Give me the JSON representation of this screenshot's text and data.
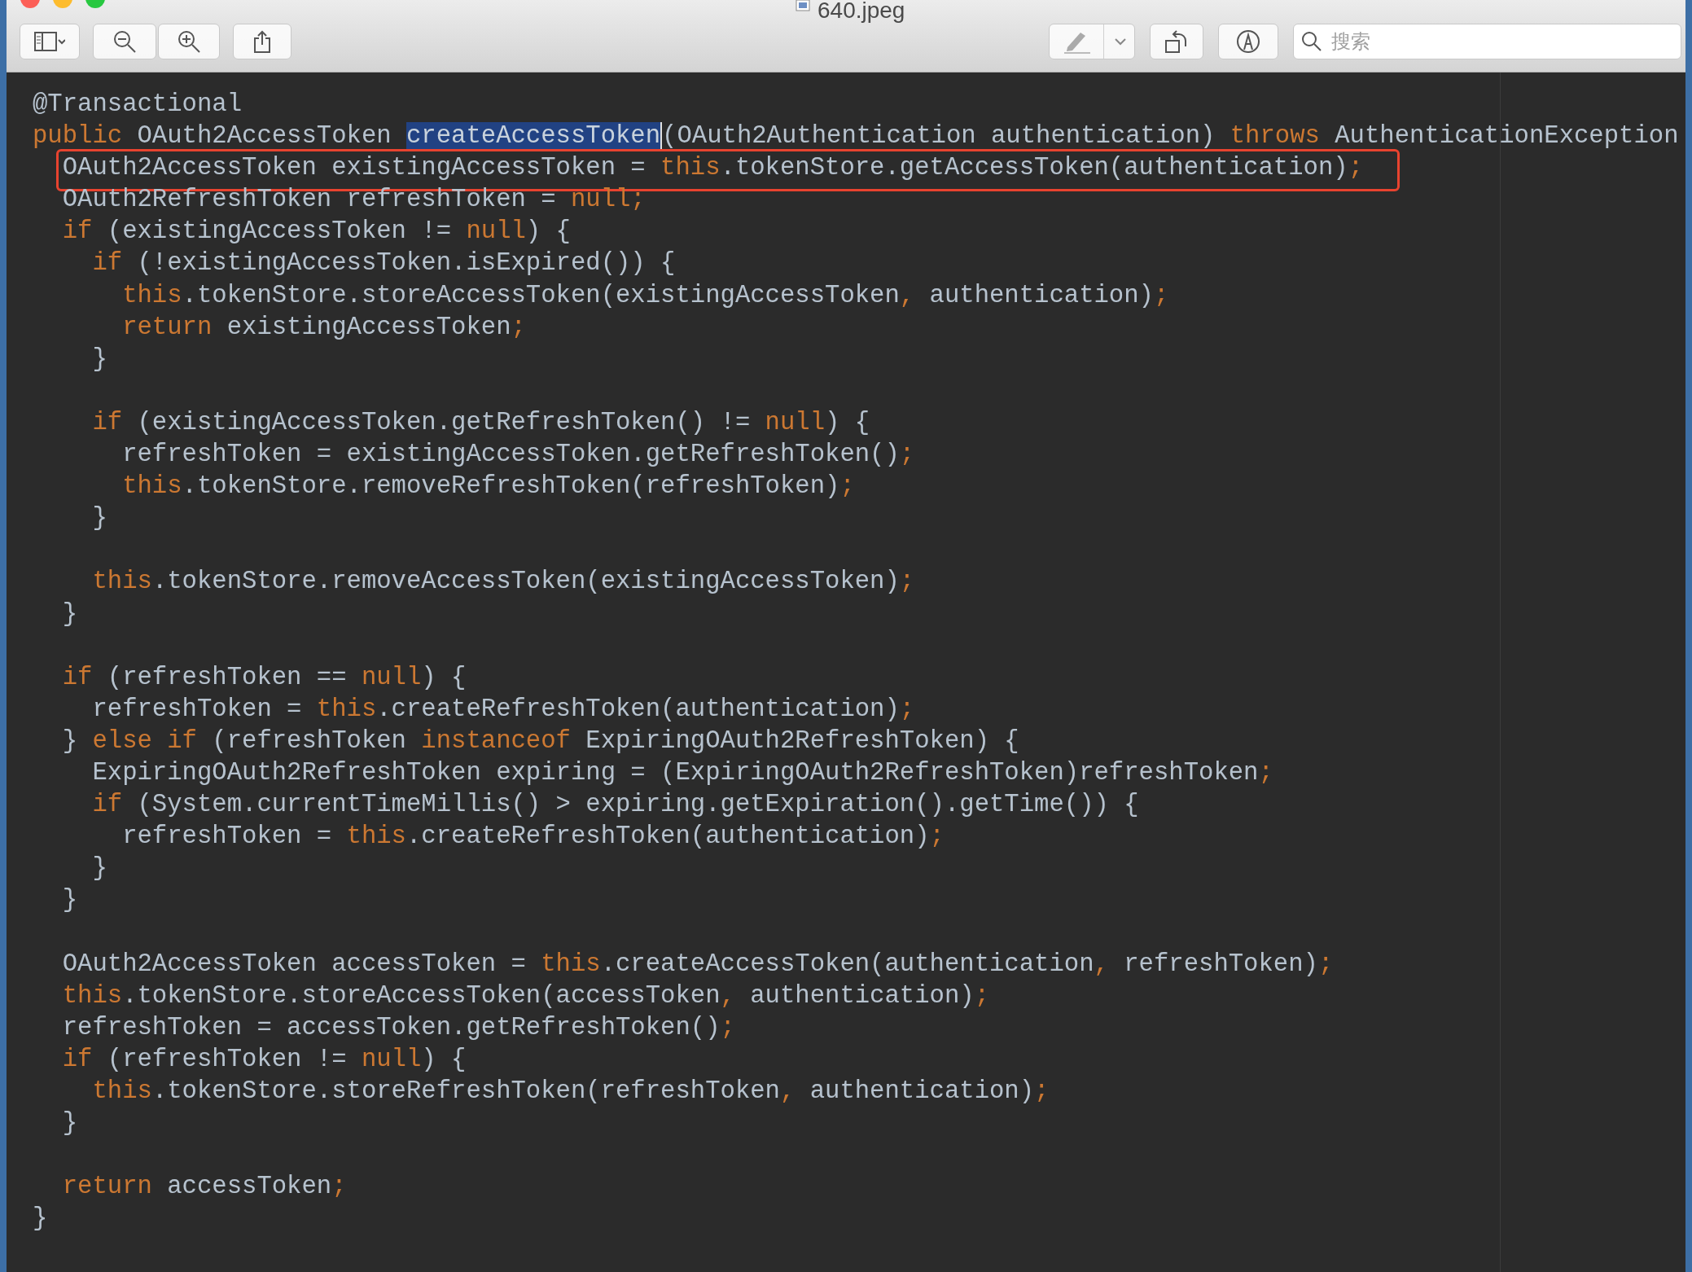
{
  "window": {
    "title": "640.jpeg"
  },
  "search": {
    "placeholder": "搜索"
  },
  "code": {
    "lines": [
      {
        "kind": "code",
        "boxed": false,
        "tokens": [
          {
            "kind": "plain",
            "text": "@Transactional"
          }
        ]
      },
      {
        "kind": "code",
        "boxed": false,
        "tokens": [
          {
            "kind": "keyword",
            "text": "public"
          },
          {
            "kind": "plain",
            "text": " OAuth2AccessToken "
          },
          {
            "kind": "selected",
            "text": "createAccessToken"
          },
          {
            "kind": "plain",
            "text": "(OAuth2Authentication authentication) "
          },
          {
            "kind": "keyword",
            "text": "throws"
          },
          {
            "kind": "plain",
            "text": " AuthenticationException"
          }
        ]
      },
      {
        "kind": "code",
        "boxed": true,
        "tokens": [
          {
            "kind": "plain",
            "text": "  OAuth2AccessToken existingAccessToken = "
          },
          {
            "kind": "keyword",
            "text": "this"
          },
          {
            "kind": "plain",
            "text": ".tokenStore.getAccessToken(authentication)"
          },
          {
            "kind": "keyword",
            "text": ";"
          }
        ]
      },
      {
        "kind": "code",
        "boxed": false,
        "tokens": [
          {
            "kind": "plain",
            "text": "  OAuth2RefreshToken refreshToken = "
          },
          {
            "kind": "keyword",
            "text": "null;"
          }
        ]
      },
      {
        "kind": "code",
        "boxed": false,
        "tokens": [
          {
            "kind": "keyword",
            "text": "  if"
          },
          {
            "kind": "plain",
            "text": " (existingAccessToken != "
          },
          {
            "kind": "keyword",
            "text": "null"
          },
          {
            "kind": "plain",
            "text": ") {"
          }
        ]
      },
      {
        "kind": "code",
        "boxed": false,
        "tokens": [
          {
            "kind": "keyword",
            "text": "    if"
          },
          {
            "kind": "plain",
            "text": " (!existingAccessToken.isExpired()) {"
          }
        ]
      },
      {
        "kind": "code",
        "boxed": false,
        "tokens": [
          {
            "kind": "keyword",
            "text": "      this"
          },
          {
            "kind": "plain",
            "text": ".tokenStore.storeAccessToken(existingAccessToken"
          },
          {
            "kind": "keyword",
            "text": ","
          },
          {
            "kind": "plain",
            "text": " authentication)"
          },
          {
            "kind": "keyword",
            "text": ";"
          }
        ]
      },
      {
        "kind": "code",
        "boxed": false,
        "tokens": [
          {
            "kind": "keyword",
            "text": "      return"
          },
          {
            "kind": "plain",
            "text": " existingAccessToken"
          },
          {
            "kind": "keyword",
            "text": ";"
          }
        ]
      },
      {
        "kind": "code",
        "boxed": false,
        "tokens": [
          {
            "kind": "plain",
            "text": "    }"
          }
        ]
      },
      {
        "kind": "blank"
      },
      {
        "kind": "code",
        "boxed": false,
        "tokens": [
          {
            "kind": "keyword",
            "text": "    if"
          },
          {
            "kind": "plain",
            "text": " (existingAccessToken.getRefreshToken() != "
          },
          {
            "kind": "keyword",
            "text": "null"
          },
          {
            "kind": "plain",
            "text": ") {"
          }
        ]
      },
      {
        "kind": "code",
        "boxed": false,
        "tokens": [
          {
            "kind": "plain",
            "text": "      refreshToken = existingAccessToken.getRefreshToken()"
          },
          {
            "kind": "keyword",
            "text": ";"
          }
        ]
      },
      {
        "kind": "code",
        "boxed": false,
        "tokens": [
          {
            "kind": "keyword",
            "text": "      this"
          },
          {
            "kind": "plain",
            "text": ".tokenStore.removeRefreshToken(refreshToken)"
          },
          {
            "kind": "keyword",
            "text": ";"
          }
        ]
      },
      {
        "kind": "code",
        "boxed": false,
        "tokens": [
          {
            "kind": "plain",
            "text": "    }"
          }
        ]
      },
      {
        "kind": "blank"
      },
      {
        "kind": "code",
        "boxed": false,
        "tokens": [
          {
            "kind": "keyword",
            "text": "    this"
          },
          {
            "kind": "plain",
            "text": ".tokenStore.removeAccessToken(existingAccessToken)"
          },
          {
            "kind": "keyword",
            "text": ";"
          }
        ]
      },
      {
        "kind": "code",
        "boxed": false,
        "tokens": [
          {
            "kind": "plain",
            "text": "  }"
          }
        ]
      },
      {
        "kind": "blank"
      },
      {
        "kind": "code",
        "boxed": false,
        "tokens": [
          {
            "kind": "keyword",
            "text": "  if"
          },
          {
            "kind": "plain",
            "text": " (refreshToken == "
          },
          {
            "kind": "keyword",
            "text": "null"
          },
          {
            "kind": "plain",
            "text": ") {"
          }
        ]
      },
      {
        "kind": "code",
        "boxed": false,
        "tokens": [
          {
            "kind": "plain",
            "text": "    refreshToken = "
          },
          {
            "kind": "keyword",
            "text": "this"
          },
          {
            "kind": "plain",
            "text": ".createRefreshToken(authentication)"
          },
          {
            "kind": "keyword",
            "text": ";"
          }
        ]
      },
      {
        "kind": "code",
        "boxed": false,
        "tokens": [
          {
            "kind": "plain",
            "text": "  } "
          },
          {
            "kind": "keyword",
            "text": "else if"
          },
          {
            "kind": "plain",
            "text": " (refreshToken "
          },
          {
            "kind": "keyword",
            "text": "instanceof"
          },
          {
            "kind": "plain",
            "text": " ExpiringOAuth2RefreshToken) {"
          }
        ]
      },
      {
        "kind": "code",
        "boxed": false,
        "tokens": [
          {
            "kind": "plain",
            "text": "    ExpiringOAuth2RefreshToken expiring = (ExpiringOAuth2RefreshToken)refreshToken"
          },
          {
            "kind": "keyword",
            "text": ";"
          }
        ]
      },
      {
        "kind": "code",
        "boxed": false,
        "tokens": [
          {
            "kind": "keyword",
            "text": "    if"
          },
          {
            "kind": "plain",
            "text": " (System.currentTimeMillis() > expiring.getExpiration().getTime()) {"
          }
        ]
      },
      {
        "kind": "code",
        "boxed": false,
        "tokens": [
          {
            "kind": "plain",
            "text": "      refreshToken = "
          },
          {
            "kind": "keyword",
            "text": "this"
          },
          {
            "kind": "plain",
            "text": ".createRefreshToken(authentication)"
          },
          {
            "kind": "keyword",
            "text": ";"
          }
        ]
      },
      {
        "kind": "code",
        "boxed": false,
        "tokens": [
          {
            "kind": "plain",
            "text": "    }"
          }
        ]
      },
      {
        "kind": "code",
        "boxed": false,
        "tokens": [
          {
            "kind": "plain",
            "text": "  }"
          }
        ]
      },
      {
        "kind": "blank"
      },
      {
        "kind": "code",
        "boxed": false,
        "tokens": [
          {
            "kind": "plain",
            "text": "  OAuth2AccessToken accessToken = "
          },
          {
            "kind": "keyword",
            "text": "this"
          },
          {
            "kind": "plain",
            "text": ".createAccessToken(authentication"
          },
          {
            "kind": "keyword",
            "text": ","
          },
          {
            "kind": "plain",
            "text": " refreshToken)"
          },
          {
            "kind": "keyword",
            "text": ";"
          }
        ]
      },
      {
        "kind": "code",
        "boxed": false,
        "tokens": [
          {
            "kind": "keyword",
            "text": "  this"
          },
          {
            "kind": "plain",
            "text": ".tokenStore.storeAccessToken(accessToken"
          },
          {
            "kind": "keyword",
            "text": ","
          },
          {
            "kind": "plain",
            "text": " authentication)"
          },
          {
            "kind": "keyword",
            "text": ";"
          }
        ]
      },
      {
        "kind": "code",
        "boxed": false,
        "tokens": [
          {
            "kind": "plain",
            "text": "  refreshToken = accessToken.getRefreshToken()"
          },
          {
            "kind": "keyword",
            "text": ";"
          }
        ]
      },
      {
        "kind": "code",
        "boxed": false,
        "tokens": [
          {
            "kind": "keyword",
            "text": "  if"
          },
          {
            "kind": "plain",
            "text": " (refreshToken != "
          },
          {
            "kind": "keyword",
            "text": "null"
          },
          {
            "kind": "plain",
            "text": ") {"
          }
        ]
      },
      {
        "kind": "code",
        "boxed": false,
        "tokens": [
          {
            "kind": "keyword",
            "text": "    this"
          },
          {
            "kind": "plain",
            "text": ".tokenStore.storeRefreshToken(refreshToken"
          },
          {
            "kind": "keyword",
            "text": ","
          },
          {
            "kind": "plain",
            "text": " authentication)"
          },
          {
            "kind": "keyword",
            "text": ";"
          }
        ]
      },
      {
        "kind": "code",
        "boxed": false,
        "tokens": [
          {
            "kind": "plain",
            "text": "  }"
          }
        ]
      },
      {
        "kind": "blank"
      },
      {
        "kind": "code",
        "boxed": false,
        "tokens": [
          {
            "kind": "keyword",
            "text": "  return"
          },
          {
            "kind": "plain",
            "text": " accessToken"
          },
          {
            "kind": "keyword",
            "text": ";"
          }
        ]
      },
      {
        "kind": "code",
        "boxed": false,
        "tokens": [
          {
            "kind": "plain",
            "text": "}"
          }
        ]
      }
    ]
  }
}
